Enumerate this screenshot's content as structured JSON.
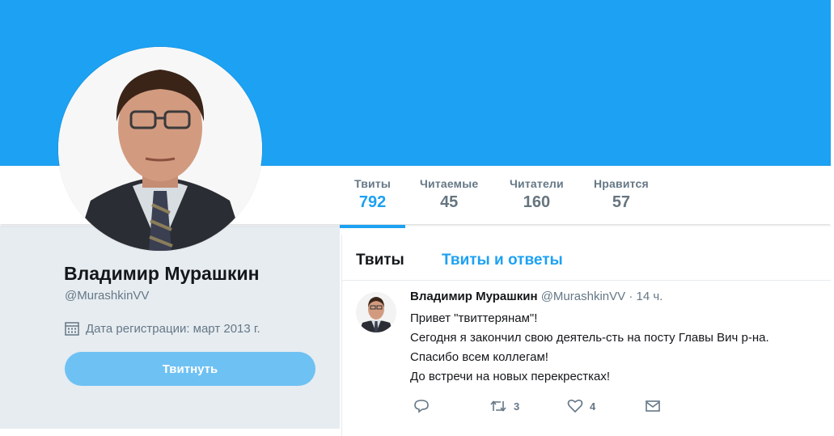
{
  "profile": {
    "name": "Владимир Мурашкин",
    "handle": "@MurashkinVV",
    "joined": "Дата регистрации: март 2013 г.",
    "tweet_button": "Твитнуть"
  },
  "stats": [
    {
      "label": "Твиты",
      "value": "792",
      "active": true
    },
    {
      "label": "Читаемые",
      "value": "45",
      "active": false
    },
    {
      "label": "Читатели",
      "value": "160",
      "active": false
    },
    {
      "label": "Нравится",
      "value": "57",
      "active": false
    }
  ],
  "tabs": {
    "tweets": "Твиты",
    "tweets_replies": "Твиты и ответы"
  },
  "tweet": {
    "author": "Владимир Мурашкин",
    "handle": "@MurashkinVV",
    "separator": "·",
    "time": "14 ч.",
    "lines": [
      "Привет \"твиттерянам\"!",
      "Сегодня я закончил свою деятель-сть на посту Главы Вич р-на.",
      "Спасибо всем коллегам!",
      "До встречи на новых перекрестках!"
    ],
    "retweets": "3",
    "likes": "4"
  },
  "colors": {
    "accent": "#1da1f2",
    "button": "#6ec1f3",
    "left_background": "#e6ecf0"
  },
  "icons": [
    "calendar-icon",
    "reply-icon",
    "retweet-icon",
    "like-icon",
    "message-icon"
  ]
}
